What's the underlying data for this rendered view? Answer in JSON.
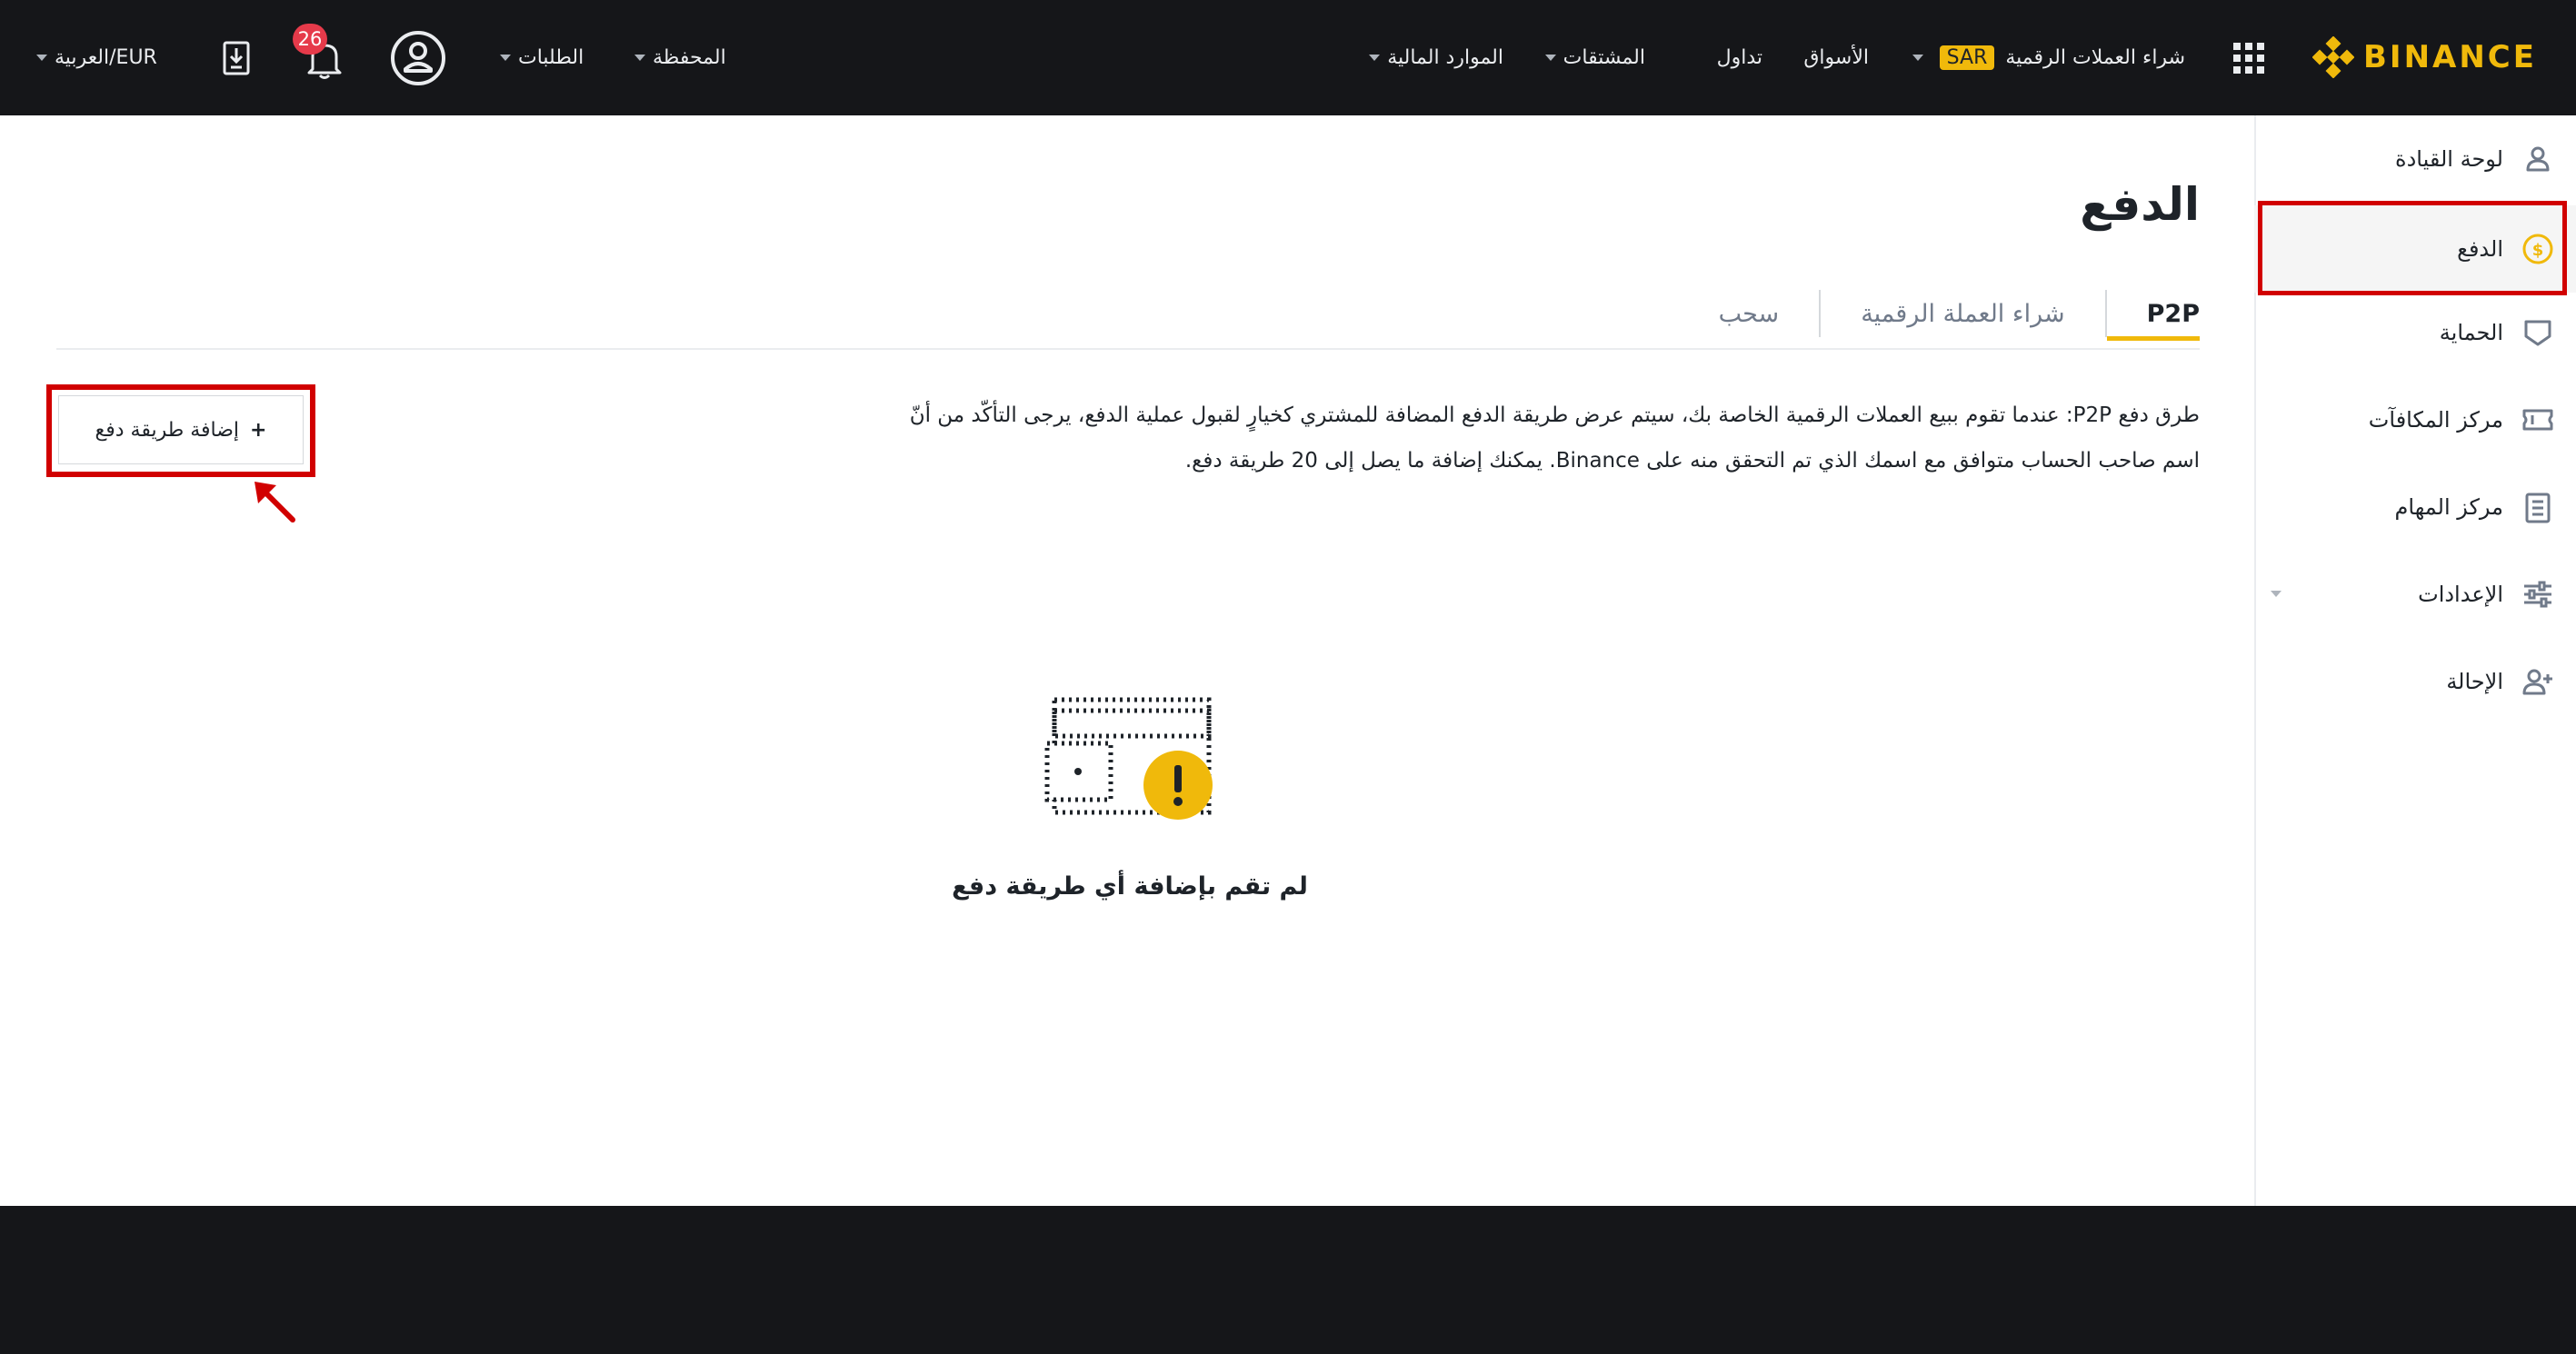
{
  "header": {
    "brand": "BINANCE",
    "nav": {
      "buy_crypto": "شراء العملات الرقمية",
      "currency_badge": "SAR",
      "markets": "الأسواق",
      "trade": "تداول",
      "derivatives": "المشتقات",
      "finance": "الموارد المالية",
      "wallet": "المحفظة",
      "orders": "الطلبات",
      "notifications_count": "26",
      "language_currency": "العربية/EUR"
    }
  },
  "sidebar": {
    "items": [
      {
        "label": "لوحة القيادة",
        "icon": "user-icon"
      },
      {
        "label": "الدفع",
        "icon": "dollar-circle-icon"
      },
      {
        "label": "الحماية",
        "icon": "shield-icon"
      },
      {
        "label": "مركز المكافآت",
        "icon": "ticket-icon"
      },
      {
        "label": "مركز المهام",
        "icon": "checklist-icon"
      },
      {
        "label": "الإعدادات",
        "icon": "sliders-icon"
      },
      {
        "label": "الإحالة",
        "icon": "add-user-icon"
      }
    ]
  },
  "main": {
    "title": "الدفع",
    "tabs": [
      {
        "label": "P2P"
      },
      {
        "label": "شراء العملة الرقمية"
      },
      {
        "label": "سحب"
      }
    ],
    "description": "طرق دفع P2P: عندما تقوم ببيع العملات الرقمية الخاصة بك، سيتم عرض طريقة الدفع المضافة للمشتري كخيارٍ لقبول عملية الدفع، يرجى التأكّد من أنّ اسم صاحب الحساب متوافق مع اسمك الذي تم التحقق منه على Binance. يمكنك إضافة ما يصل إلى 20 طريقة دفع.",
    "add_button": "إضافة طريقة دفع",
    "add_icon": "+",
    "empty_state": "لم تقم بإضافة أي طريقة دفع"
  },
  "colors": {
    "accent": "#f0b90b",
    "highlight": "#d10000",
    "topbar": "#151619"
  }
}
